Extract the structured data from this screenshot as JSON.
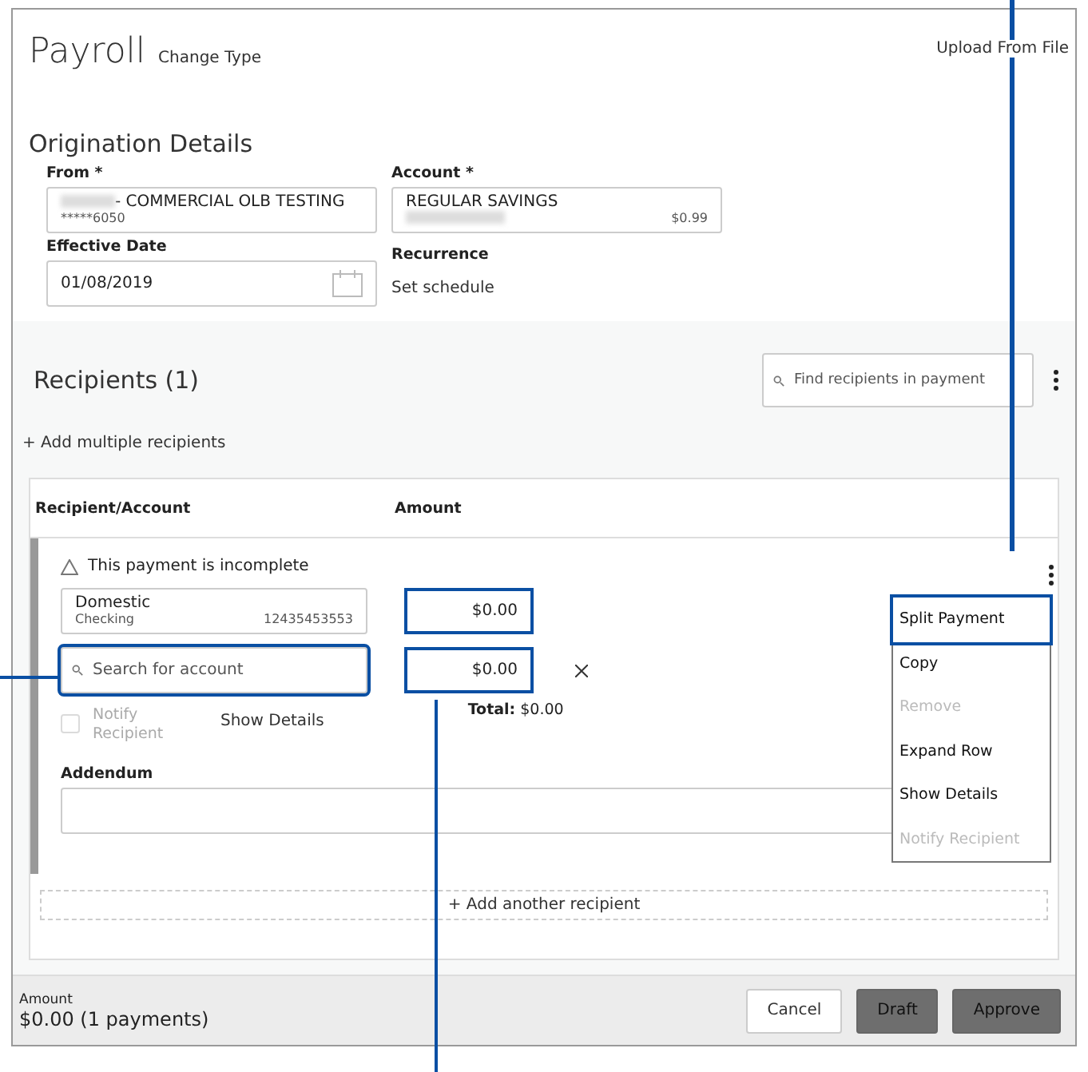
{
  "header": {
    "title": "Payroll",
    "change_type": "Change Type",
    "upload": "Upload From File"
  },
  "origination": {
    "title": "Origination Details",
    "from": {
      "label": "From *",
      "value": "- COMMERCIAL OLB TESTING",
      "sub": "*****6050"
    },
    "account": {
      "label": "Account *",
      "value": "REGULAR SAVINGS",
      "balance": "$0.99"
    },
    "effective_date": {
      "label": "Effective Date",
      "value": "01/08/2019"
    },
    "recurrence": {
      "label": "Recurrence",
      "value": "Set schedule"
    }
  },
  "recipients": {
    "title": "Recipients (1)",
    "search_placeholder": "Find recipients in payment",
    "add_multiple": "+ Add multiple recipients",
    "columns": [
      "Recipient/Account",
      "Amount"
    ],
    "row": {
      "warning": "This payment is incomplete",
      "account": {
        "name": "Domestic",
        "type": "Checking",
        "number": "12435453553"
      },
      "amounts": [
        {
          "value": "$0.00",
          "highlighted": true
        },
        {
          "value": "$0.00",
          "highlighted": true
        }
      ],
      "search_placeholder": "Search for account",
      "search_highlighted": true,
      "notify": {
        "label": "Notify Recipient",
        "checked": false,
        "disabled": true
      },
      "show_details": "Show Details",
      "total_label": "Total:",
      "total": "$0.00",
      "addendum_label": "Addendum",
      "menu": [
        {
          "label": "Split Payment",
          "disabled": false,
          "highlighted": true
        },
        {
          "label": "Copy",
          "disabled": false,
          "highlighted": false
        },
        {
          "label": "Remove",
          "disabled": true,
          "highlighted": false
        },
        {
          "label": "Expand Row",
          "disabled": false,
          "highlighted": false
        },
        {
          "label": "Show Details",
          "disabled": false,
          "highlighted": false
        },
        {
          "label": "Notify Recipient",
          "disabled": true,
          "highlighted": false
        }
      ]
    },
    "add_another": "+ Add another recipient"
  },
  "footer": {
    "label": "Amount",
    "summary": "$0.00 (1 payments)",
    "buttons": [
      {
        "label": "Cancel",
        "kind": "secondary"
      },
      {
        "label": "Draft",
        "kind": "primary"
      },
      {
        "label": "Approve",
        "kind": "primary"
      }
    ]
  }
}
